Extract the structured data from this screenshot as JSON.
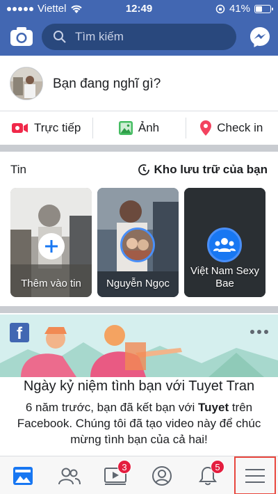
{
  "status_bar": {
    "carrier": "Viettel",
    "time": "12:49",
    "battery": "41%",
    "battery_level": 0.41
  },
  "header": {
    "search": {
      "placeholder": "Tìm kiếm",
      "value": ""
    },
    "icons": [
      "camera-icon",
      "search-icon",
      "messenger-icon"
    ]
  },
  "composer": {
    "prompt": "Bạn đang nghĩ gì?"
  },
  "actions": [
    {
      "label": "Trực tiếp",
      "icon": "live-video-icon",
      "color": "#f02849"
    },
    {
      "label": "Ảnh",
      "icon": "photo-icon",
      "color": "#45bd62"
    },
    {
      "label": "Check in",
      "icon": "location-pin-icon",
      "color": "#f3425f"
    }
  ],
  "stories": {
    "title": "Tin",
    "archive_label": "Kho lưu trữ của bạn",
    "cards": [
      {
        "label": "Thêm vào tin"
      },
      {
        "label": "Nguyễn Ngọc"
      },
      {
        "label": "Việt Nam Sexy Bae"
      }
    ]
  },
  "memory": {
    "title": "Ngày kỷ niệm tình bạn với Tuyet Tran",
    "text_before": "6 năm trước, bạn đã kết bạn với ",
    "text_bold": "Tuyet",
    "text_after": " trên Facebook. Chúng tôi đã tạo video này để chúc mừng tình bạn của cả hai!"
  },
  "bottom_nav": {
    "tabs": [
      {
        "icon": "news-feed-icon",
        "badge": ""
      },
      {
        "icon": "friends-icon",
        "badge": ""
      },
      {
        "icon": "watch-video-icon",
        "badge": "3"
      },
      {
        "icon": "profile-icon",
        "badge": ""
      },
      {
        "icon": "notifications-bell-icon",
        "badge": "5"
      },
      {
        "icon": "menu-icon",
        "badge": ""
      }
    ]
  },
  "colors": {
    "brand": "#4267b2",
    "search_bg": "#29487d",
    "badge": "#e41e3f",
    "highlight": "#e8453c"
  }
}
